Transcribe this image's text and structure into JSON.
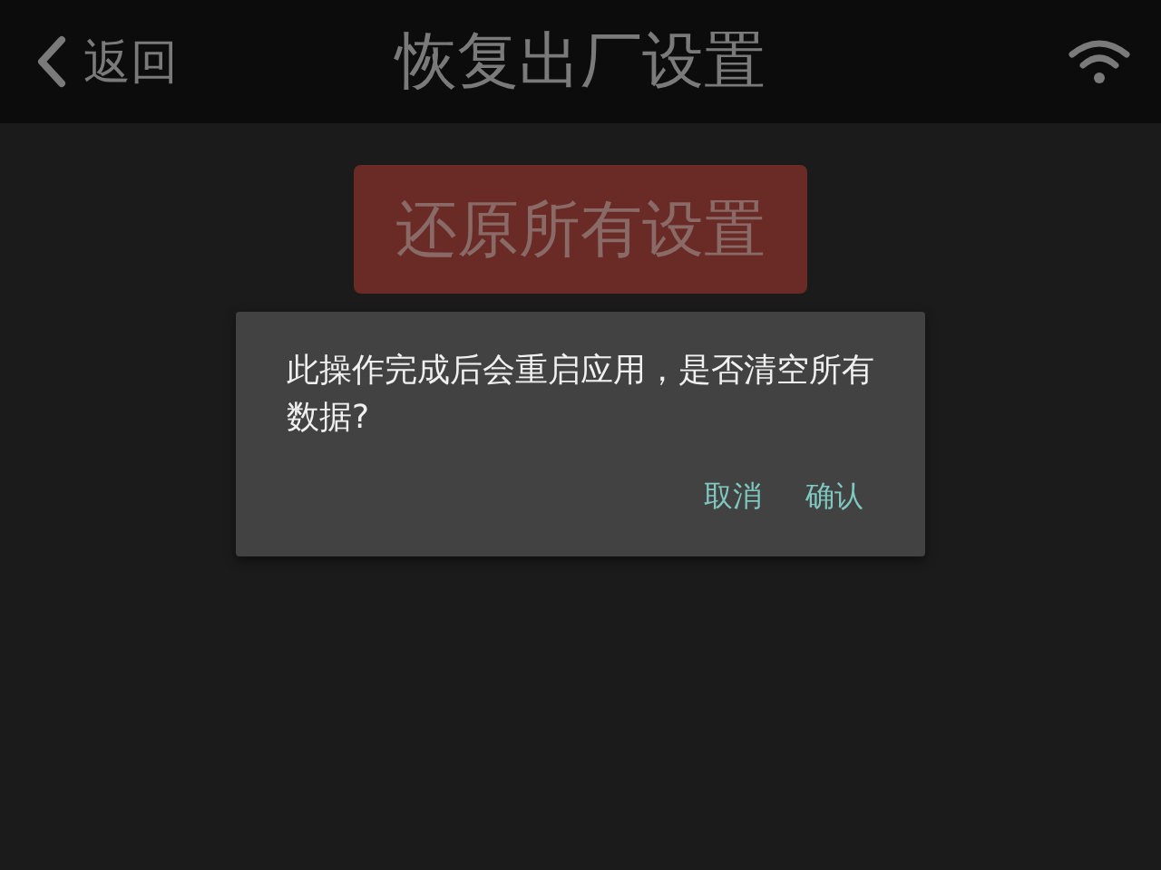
{
  "header": {
    "back_label": "返回",
    "title": "恢复出厂设置"
  },
  "reset_button": {
    "label": "还原所有设置"
  },
  "dialog": {
    "message": "此操作完成后会重启应用，是否清空所有数据?",
    "buttons": [
      {
        "label": "取消"
      },
      {
        "label": "确认"
      }
    ]
  }
}
